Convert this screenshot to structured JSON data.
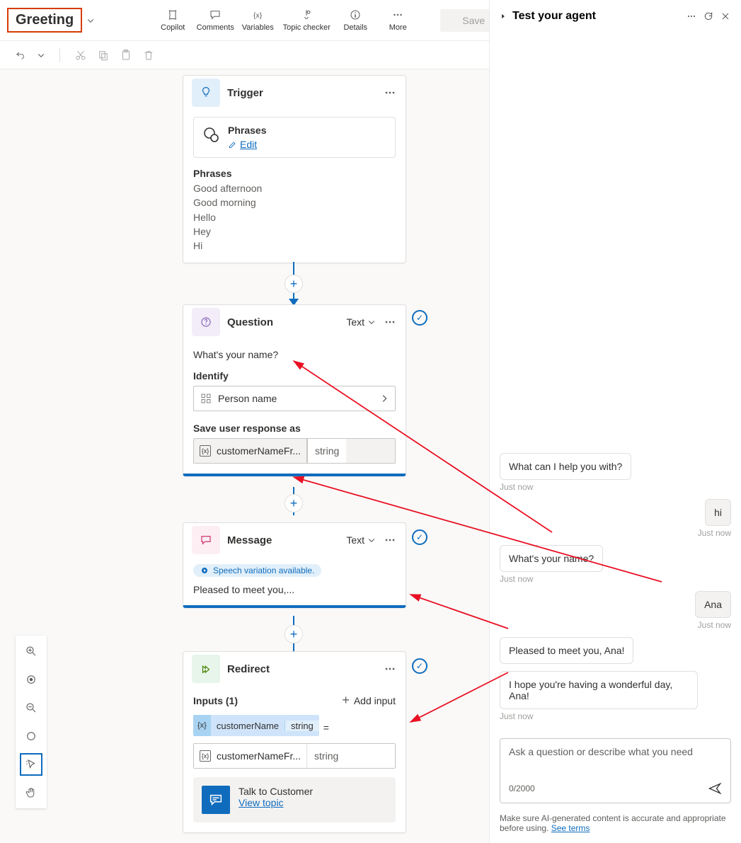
{
  "topic_title": "Greeting",
  "toolbar": {
    "copilot": "Copilot",
    "comments": "Comments",
    "variables": "Variables",
    "topic_checker": "Topic checker",
    "details": "Details",
    "more": "More",
    "save": "Save"
  },
  "nodes": {
    "trigger": {
      "title": "Trigger",
      "phrases_title": "Phrases",
      "edit": "Edit",
      "phrases_label": "Phrases",
      "phrases": [
        "Good afternoon",
        "Good morning",
        "Hello",
        "Hey",
        "Hi"
      ]
    },
    "question": {
      "title": "Question",
      "type": "Text",
      "prompt": "What's your name?",
      "identify_label": "Identify",
      "identify_value": "Person name",
      "save_label": "Save user response as",
      "var_name": "customerNameFr...",
      "var_type": "string"
    },
    "message": {
      "title": "Message",
      "type": "Text",
      "speech_chip": "Speech variation available.",
      "text": "Pleased to meet you,..."
    },
    "redirect": {
      "title": "Redirect",
      "inputs_label": "Inputs (1)",
      "add_input": "Add input",
      "input_name": "customerName",
      "input_type": "string",
      "eq": "=",
      "expr_name": "customerNameFr...",
      "expr_type": "string",
      "talk": "Talk to Customer",
      "view_topic": "View topic"
    }
  },
  "right": {
    "title": "Test your agent",
    "chat": [
      {
        "who": "bot",
        "text": "What can I help you with?",
        "ts": "Just now"
      },
      {
        "who": "user",
        "text": "hi",
        "ts": "Just now"
      },
      {
        "who": "bot",
        "text": "What's your name?",
        "ts": "Just now"
      },
      {
        "who": "user",
        "text": "Ana",
        "ts": "Just now"
      },
      {
        "who": "bot",
        "text": "Pleased to meet you, Ana!",
        "ts": ""
      },
      {
        "who": "bot",
        "text": "I hope you're having a wonderful day, Ana!",
        "ts": "Just now"
      }
    ],
    "placeholder": "Ask a question or describe what you need",
    "counter": "0/2000",
    "disclaimer": "Make sure AI-generated content is accurate and appropriate before using. ",
    "see_terms": "See terms"
  }
}
